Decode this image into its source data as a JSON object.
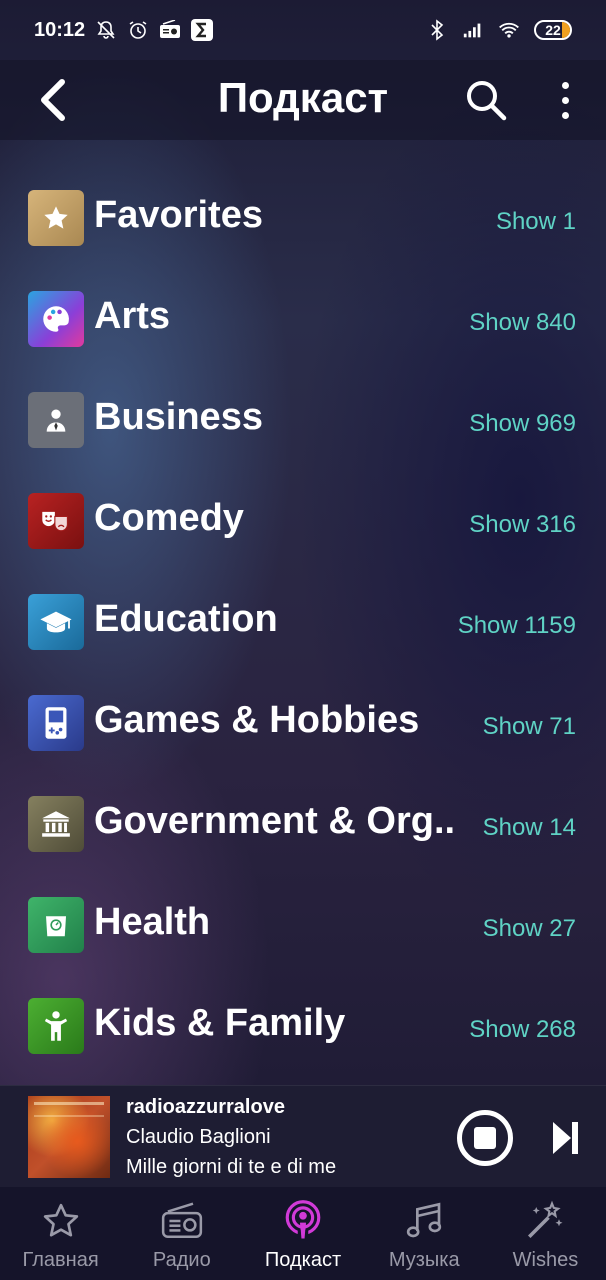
{
  "status_bar": {
    "time": "10:12",
    "battery": "22"
  },
  "header": {
    "title": "Подкаст"
  },
  "categories": [
    {
      "label": "Favorites",
      "count": "Show 1",
      "icon": "star-icon",
      "color": "#c9a76a"
    },
    {
      "label": "Arts",
      "count": "Show 840",
      "icon": "palette-icon",
      "color": "#8a4fd6"
    },
    {
      "label": "Business",
      "count": "Show 969",
      "icon": "businessman-icon",
      "color": "#6b6f78"
    },
    {
      "label": "Comedy",
      "count": "Show 316",
      "icon": "theater-masks-icon",
      "color": "#a41c1c"
    },
    {
      "label": "Education",
      "count": "Show 1159",
      "icon": "graduation-cap-icon",
      "color": "#2b86c0"
    },
    {
      "label": "Games & Hobbies",
      "count": "Show 71",
      "icon": "handheld-game-icon",
      "color": "#3a56b8"
    },
    {
      "label": "Government & Org..",
      "count": "Show 14",
      "icon": "government-building-icon",
      "color": "#6d6a55"
    },
    {
      "label": "Health",
      "count": "Show 27",
      "icon": "health-scale-icon",
      "color": "#2f9c5a"
    },
    {
      "label": "Kids & Family",
      "count": "Show 268",
      "icon": "child-icon",
      "color": "#3c9a2a"
    }
  ],
  "player": {
    "station": "radioazzurralove",
    "artist": "Claudio Baglioni",
    "track": "Mille giorni di te e di me"
  },
  "nav": [
    {
      "label": "Главная",
      "icon": "star-outline-icon"
    },
    {
      "label": "Радио",
      "icon": "radio-icon"
    },
    {
      "label": "Подкаст",
      "icon": "podcast-icon",
      "active": true
    },
    {
      "label": "Музыка",
      "icon": "music-note-icon"
    },
    {
      "label": "Wishes",
      "icon": "magic-wand-icon"
    }
  ],
  "colors": {
    "accent_count": "#5fd3c5",
    "podcast_active": "#d13ad8"
  }
}
